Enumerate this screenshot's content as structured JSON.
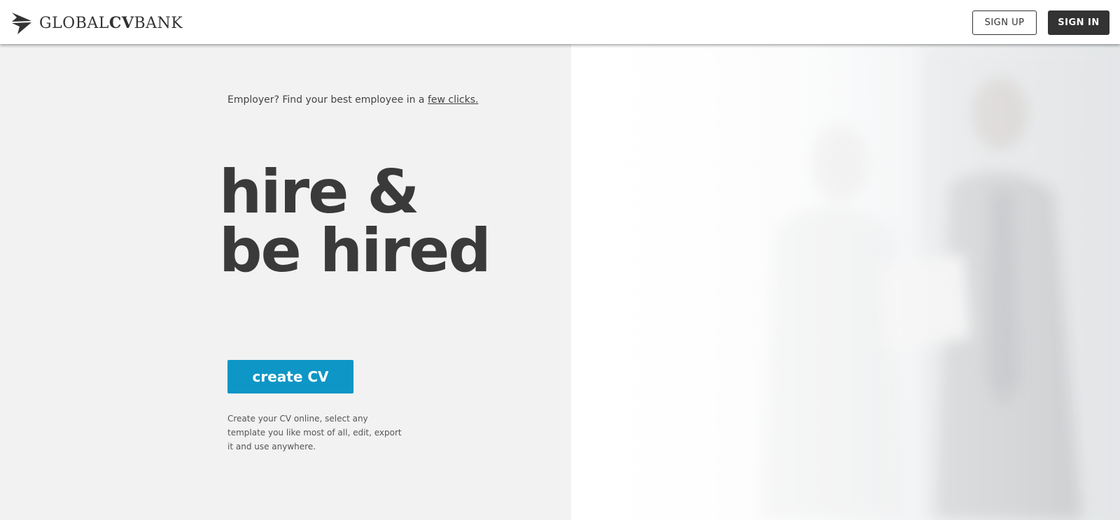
{
  "header": {
    "logo": {
      "icon": "paper-plane-icon",
      "text_part1": "GLOBAL",
      "text_part2": "CV",
      "text_part3": "BANK"
    },
    "signup_label": "SIGN UP",
    "signin_label": "SIGN IN"
  },
  "hero": {
    "employer_prefix": "Employer? Find your best employee in a ",
    "employer_link": "few clicks.",
    "headline_line1": "hire &",
    "headline_line2": "be hired",
    "cta_label": "create CV",
    "description": "Create your CV online, select any template you like most of all, edit, export it and use anywhere."
  },
  "colors": {
    "accent": "#0d96c6",
    "dark": "#333333",
    "background": "#f2f2f2"
  }
}
